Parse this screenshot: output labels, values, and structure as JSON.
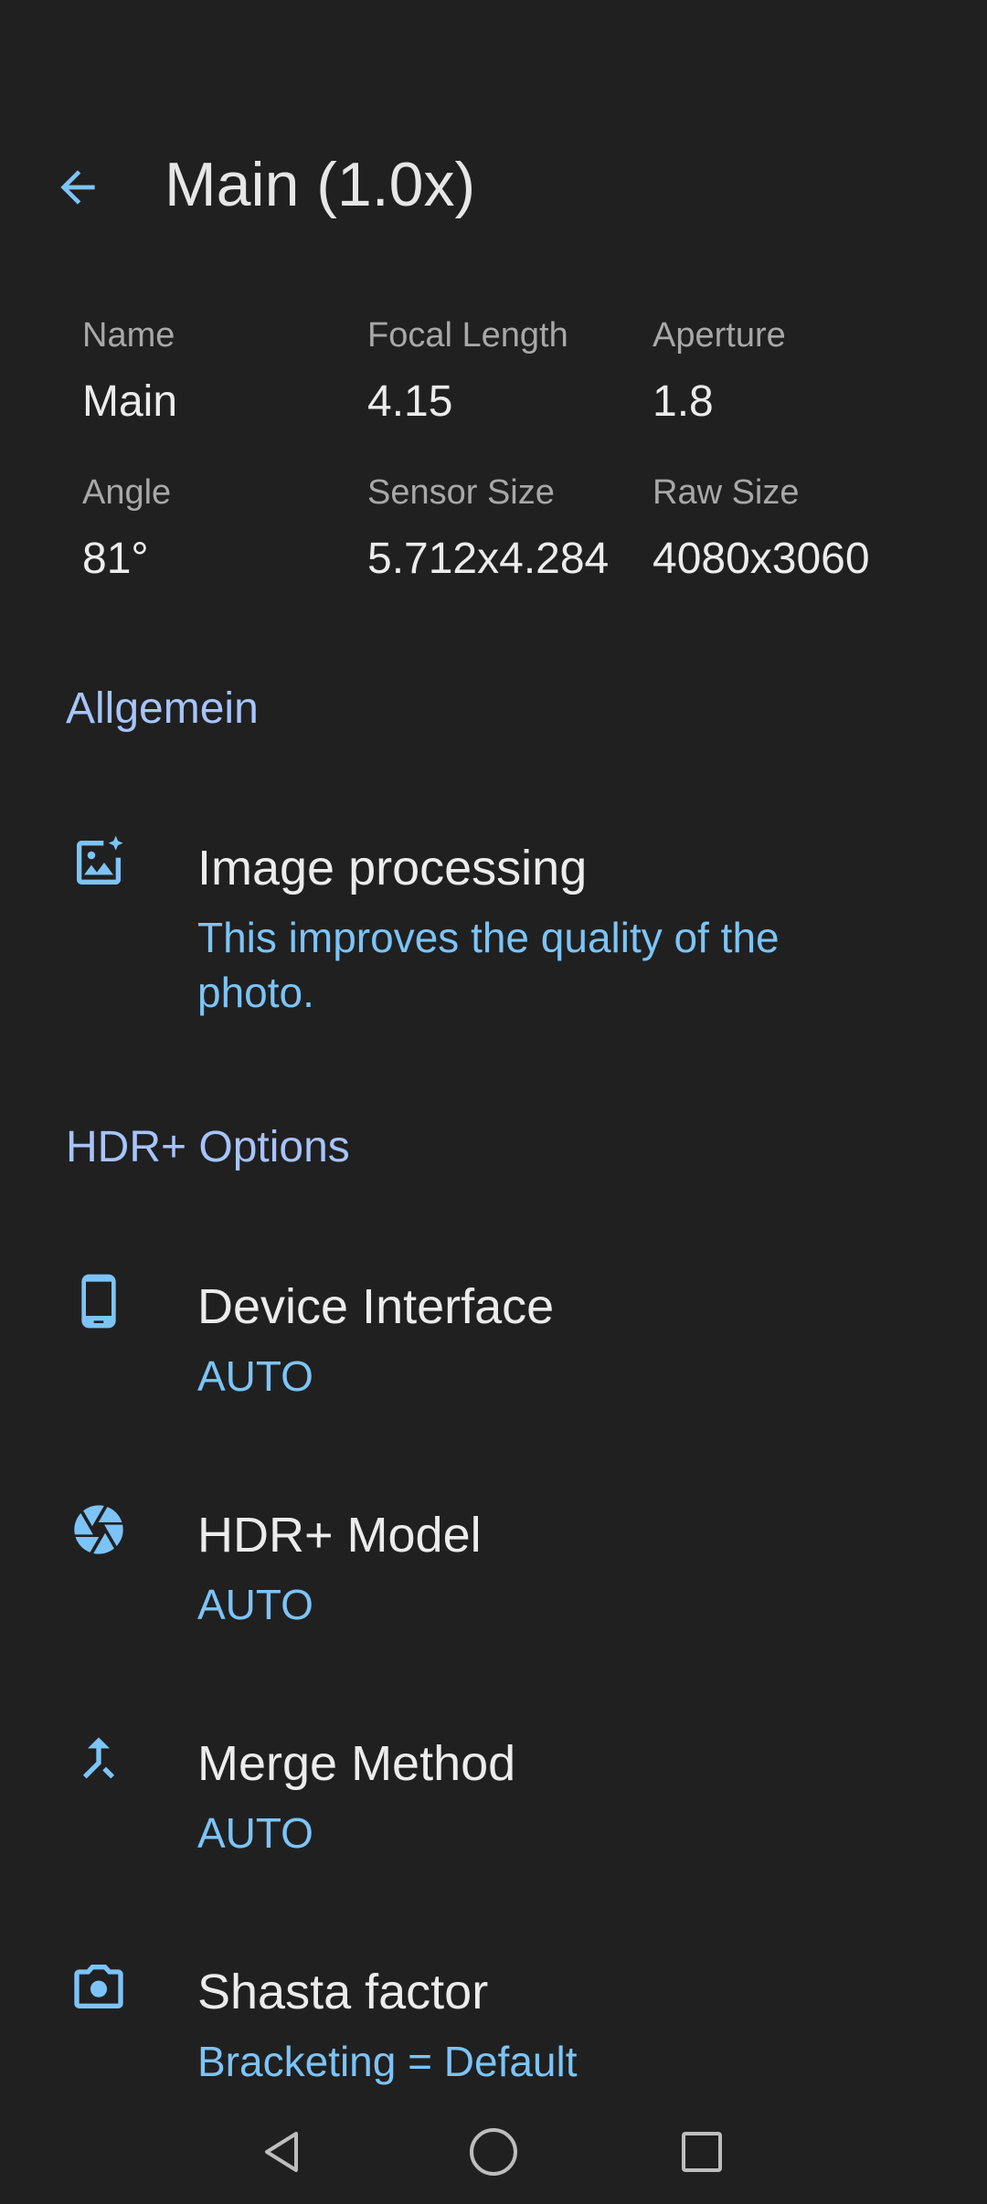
{
  "header": {
    "title": "Main (1.0x)",
    "back_icon": "arrow-back-icon"
  },
  "specs": {
    "name": {
      "label": "Name",
      "value": "Main"
    },
    "focal_length": {
      "label": "Focal Length",
      "value": "4.15"
    },
    "aperture": {
      "label": "Aperture",
      "value": "1.8"
    },
    "angle": {
      "label": "Angle",
      "value": "81°"
    },
    "sensor_size": {
      "label": "Sensor Size",
      "value": "5.712x4.284"
    },
    "raw_size": {
      "label": "Raw Size",
      "value": "4080x3060"
    }
  },
  "sections": {
    "general": "Allgemein",
    "hdr": "HDR+ Options"
  },
  "prefs": {
    "image_processing": {
      "title": "Image processing",
      "summary": "This improves the quality of the photo.",
      "icon": "image-sparkle-icon"
    },
    "device_interface": {
      "title": "Device Interface",
      "summary": "AUTO",
      "icon": "smartphone-icon"
    },
    "hdr_model": {
      "title": "HDR+ Model",
      "summary": "AUTO",
      "icon": "camera-shutter-icon"
    },
    "merge_method": {
      "title": "Merge Method",
      "summary": "AUTO",
      "icon": "merge-icon"
    },
    "shasta_factor": {
      "title": "Shasta factor",
      "summary": "Bracketing = Default",
      "icon": "camera-icon"
    }
  },
  "colors": {
    "background": "#202020",
    "accent": "#7cc4f8",
    "section_header": "#a7c4ff",
    "title_text": "#ececec",
    "label_text": "#a8a8a8"
  },
  "navigation": {
    "back": "nav-back-icon",
    "home": "nav-home-icon",
    "recents": "nav-recents-icon"
  }
}
